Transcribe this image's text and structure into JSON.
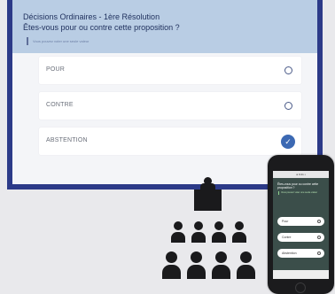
{
  "screen": {
    "title": "Décisions Ordinaires - 1ère Résolution",
    "question": "Êtes-vous pour ou contre cette proposition ?",
    "hint": "Vous pouvez voter une seule valeur",
    "options": [
      {
        "label": "POUR",
        "selected": false
      },
      {
        "label": "CONTRE",
        "selected": false
      },
      {
        "label": "ABSTENTION",
        "selected": true
      }
    ],
    "check_glyph": "✓"
  },
  "phone": {
    "status": "● 9:41 ▪",
    "question": "Êtes-vous pour ou contre cette proposition ?",
    "hint": "Vous pouvez voter une seule valeur",
    "options": [
      {
        "label": "Pour"
      },
      {
        "label": "Contre"
      },
      {
        "label": "Abstention"
      }
    ]
  },
  "colors": {
    "frame": "#2c3a88",
    "header": "#b9cde4",
    "selected": "#3c69b3",
    "phone_screen": "#3b4e4a"
  }
}
